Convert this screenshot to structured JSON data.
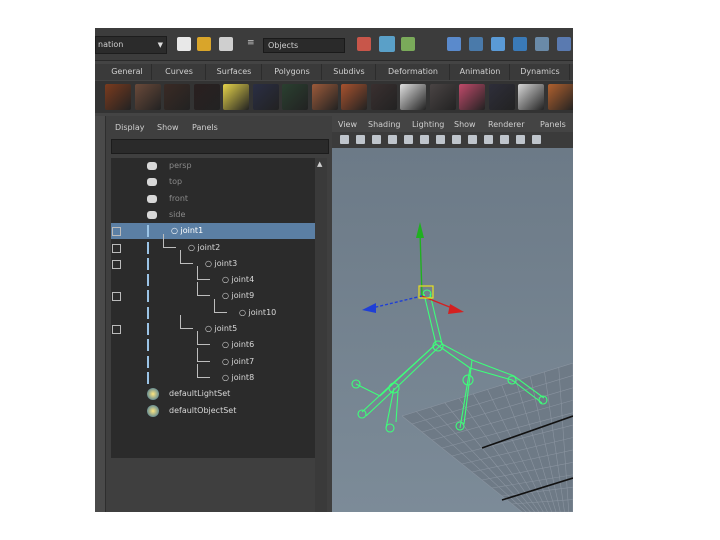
{
  "status_bar": {
    "mode_label": "nation",
    "objects_field": "Objects",
    "icons": [
      "new-scene-icon",
      "open-scene-icon",
      "save-scene-icon",
      "select-by-hierarchy-icon",
      "select-by-object-icon",
      "select-by-component-icon",
      "snap-grid-icon",
      "snap-curve-icon",
      "snap-point-icon",
      "snap-surface-icon",
      "make-live-icon"
    ]
  },
  "shelf": {
    "tabs": [
      "General",
      "Curves",
      "Surfaces",
      "Polygons",
      "Subdivs",
      "Deformation",
      "Animation",
      "Dynamics"
    ],
    "swatch_colors": [
      "#7b3b1e",
      "#6a4a3a",
      "#3a2a24",
      "#2a2020",
      "#e6d44a",
      "#2a2e44",
      "#2a4030",
      "#9c5a3a",
      "#a8522e",
      "#3a3030",
      "#e0e0e0",
      "#4a4444",
      "#c04a6a",
      "#2e2e3a",
      "#d6d6d6",
      "#b0602e"
    ]
  },
  "outliner": {
    "menu": [
      "Display",
      "Show",
      "Panels"
    ],
    "items": [
      {
        "label": "persp",
        "type": "camera",
        "depth": 0,
        "dim": true
      },
      {
        "label": "top",
        "type": "camera",
        "depth": 0,
        "dim": true
      },
      {
        "label": "front",
        "type": "camera",
        "depth": 0,
        "dim": true
      },
      {
        "label": "side",
        "type": "camera",
        "depth": 0,
        "dim": true
      },
      {
        "label": "joint1",
        "type": "joint",
        "depth": 0,
        "selected": true,
        "expander": true
      },
      {
        "label": "joint2",
        "type": "joint",
        "depth": 1,
        "expander": true
      },
      {
        "label": "joint3",
        "type": "joint",
        "depth": 2,
        "expander": true
      },
      {
        "label": "joint4",
        "type": "joint",
        "depth": 3
      },
      {
        "label": "joint9",
        "type": "joint",
        "depth": 3,
        "expander": true
      },
      {
        "label": "joint10",
        "type": "joint",
        "depth": 4
      },
      {
        "label": "joint5",
        "type": "joint",
        "depth": 2,
        "expander": true
      },
      {
        "label": "joint6",
        "type": "joint",
        "depth": 3
      },
      {
        "label": "joint7",
        "type": "joint",
        "depth": 3
      },
      {
        "label": "joint8",
        "type": "joint",
        "depth": 3
      },
      {
        "label": "defaultLightSet",
        "type": "set",
        "depth": 0
      },
      {
        "label": "defaultObjectSet",
        "type": "set",
        "depth": 0
      }
    ]
  },
  "viewport": {
    "menu": [
      "View",
      "Shading",
      "Lighting",
      "Show",
      "Renderer",
      "Panels"
    ],
    "skeleton_color": "#3dff7a",
    "move_axis_colors": {
      "x": "#d42020",
      "y": "#20b020",
      "z": "#1f3fd6"
    }
  }
}
